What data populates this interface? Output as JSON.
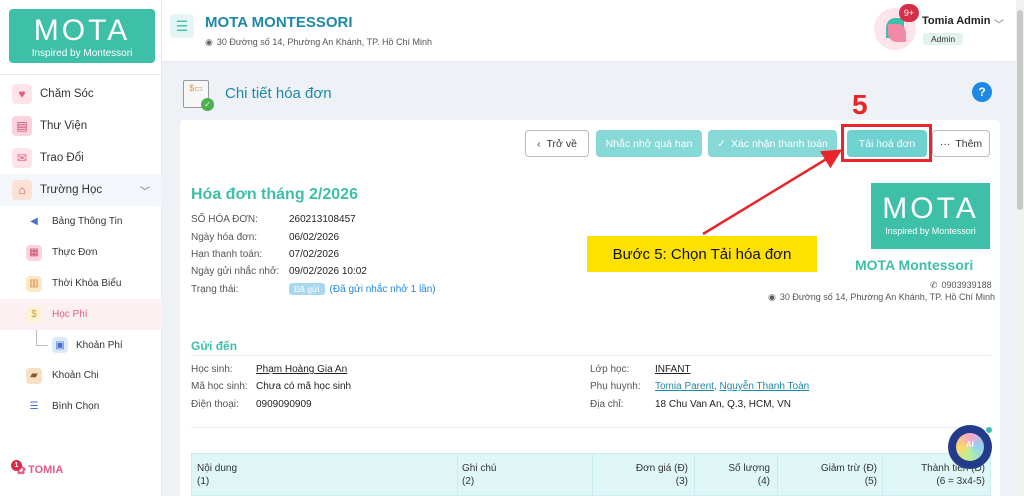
{
  "sidebar": {
    "logo_big": "MOTA",
    "logo_small": "Inspired by Montessori",
    "items": [
      {
        "label": "Chăm Sóc",
        "icon": "care-icon"
      },
      {
        "label": "Thư Viện",
        "icon": "library-icon"
      },
      {
        "label": "Trao Đổi",
        "icon": "chat-icon"
      },
      {
        "label": "Trường Học",
        "icon": "school-icon"
      },
      {
        "label": "Bảng Thông Tin",
        "icon": "megaphone-icon"
      },
      {
        "label": "Thực Đơn",
        "icon": "menu-board-icon"
      },
      {
        "label": "Thời Khóa Biểu",
        "icon": "timetable-icon"
      },
      {
        "label": "Học Phí",
        "icon": "tuition-icon"
      },
      {
        "label": "Khoản Phí",
        "icon": "fee-icon"
      },
      {
        "label": "Khoản Chi",
        "icon": "wallet-icon"
      },
      {
        "label": "Bình Chọn",
        "icon": "poll-icon"
      }
    ],
    "footer_badge": "1",
    "footer_label": "TOMIA"
  },
  "header": {
    "school_name": "MOTA MONTESSORI",
    "school_address": "30 Đường số 14, Phường An Khánh, TP. Hồ Chí Minh",
    "notification_count": "9+",
    "user_name": "Tomia Admin",
    "user_role": "Admin"
  },
  "page": {
    "title": "Chi tiết hóa đơn",
    "help": "?"
  },
  "actions": {
    "back": "Trở về",
    "remind": "Nhắc nhở quá hạn",
    "confirm": "Xác nhận thanh toán",
    "download": "Tải hoá đơn",
    "more": "Thêm"
  },
  "annotation": {
    "step_number": "5",
    "callout": "Bước 5: Chọn Tải hóa đơn",
    "color": "#e8262a"
  },
  "invoice": {
    "title": "Hóa đơn tháng 2/2026",
    "fields": [
      {
        "label": "SỐ HÓA ĐƠN:",
        "value": "260213108457"
      },
      {
        "label": "Ngày hóa đơn:",
        "value": "06/02/2026"
      },
      {
        "label": "Hạn thanh toán:",
        "value": "07/02/2026"
      },
      {
        "label": "Ngày gửi nhắc nhở:",
        "value": "09/02/2026 10:02"
      },
      {
        "label": "Trạng thái:",
        "badge": "Đã gửi",
        "note": "(Đã gửi nhắc nhở 1 lần)"
      }
    ]
  },
  "brand": {
    "logo_big": "MOTA",
    "logo_small": "Inspired by Montessori",
    "name": "MOTA Montessori",
    "phone": "0903939188",
    "address": "30 Đường số 14, Phường An Khánh, TP. Hồ Chí Minh"
  },
  "send_to": {
    "title": "Gửi đến",
    "student_label": "Học sinh:",
    "student_value": "Phạm Hoàng Gia An",
    "code_label": "Mã học sinh:",
    "code_value": "Chưa có mã học sinh",
    "phone_label": "Điện thoại:",
    "phone_value": "0909090909",
    "class_label": "Lớp học:",
    "class_value": "INFANT",
    "parent_label": "Phụ huynh:",
    "parent_value_1": "Tomia Parent",
    "parent_value_2": "Nguyễn Thanh Toàn",
    "address_label": "Địa chỉ:",
    "address_value": "18 Chu Van An, Q.3, HCM, VN"
  },
  "table": {
    "columns": [
      {
        "name": "Nội dung",
        "sub": "(1)"
      },
      {
        "name": "Ghi chú",
        "sub": "(2)"
      },
      {
        "name": "Đơn giá (Đ)",
        "sub": "(3)"
      },
      {
        "name": "Số lượng",
        "sub": "(4)"
      },
      {
        "name": "Giảm trừ (Đ)",
        "sub": "(5)"
      },
      {
        "name": "Thành tiền (Đ)",
        "sub": "(6 = 3x4-5)"
      }
    ]
  },
  "ai_button": "AI"
}
